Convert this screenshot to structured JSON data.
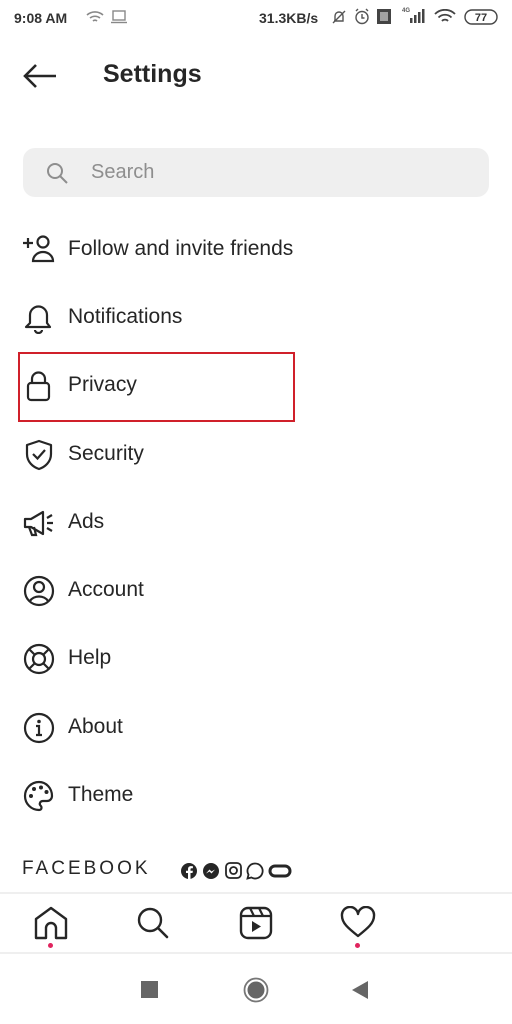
{
  "status_bar": {
    "time": "9:08 AM",
    "speed": "31.3KB/s",
    "battery": "77",
    "network": "4G"
  },
  "header": {
    "title": "Settings",
    "back_icon": "arrow-left-icon"
  },
  "search": {
    "placeholder": "Search",
    "value": ""
  },
  "items": [
    {
      "label": "Follow and invite friends",
      "icon": "add-person-icon"
    },
    {
      "label": "Notifications",
      "icon": "bell-icon"
    },
    {
      "label": "Privacy",
      "icon": "lock-icon",
      "highlighted": true
    },
    {
      "label": "Security",
      "icon": "shield-check-icon"
    },
    {
      "label": "Ads",
      "icon": "megaphone-icon"
    },
    {
      "label": "Account",
      "icon": "person-circle-icon"
    },
    {
      "label": "Help",
      "icon": "lifebuoy-icon"
    },
    {
      "label": "About",
      "icon": "info-icon"
    },
    {
      "label": "Theme",
      "icon": "palette-icon"
    }
  ],
  "facebook": {
    "label": "FACEBOOK",
    "icons": [
      "facebook-icon",
      "messenger-icon",
      "instagram-icon",
      "whatsapp-icon",
      "portal-icon"
    ]
  },
  "tabs": [
    "home",
    "search",
    "reels",
    "activity"
  ],
  "colors": {
    "highlight": "#d0202a",
    "notification_dot": "#e0245e",
    "search_bg": "#efefef"
  }
}
